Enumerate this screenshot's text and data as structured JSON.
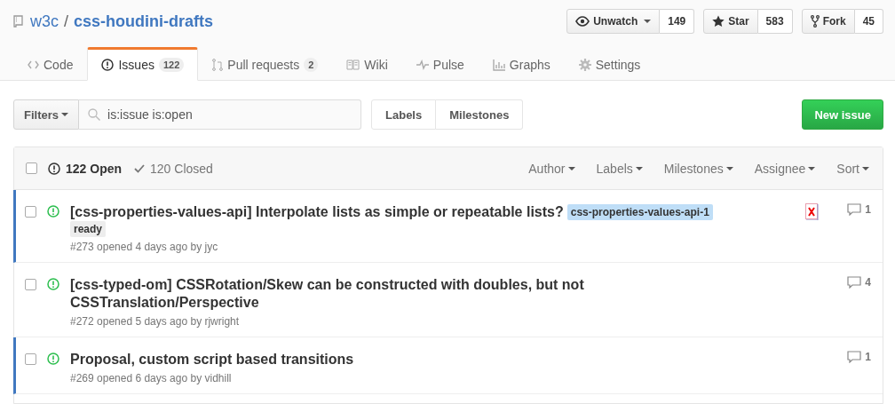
{
  "repo": {
    "owner": "w3c",
    "separator": "/",
    "name": "css-houdini-drafts"
  },
  "actions": [
    {
      "kind": "watch",
      "label": "Unwatch",
      "dropdown": true,
      "count": "149"
    },
    {
      "kind": "star",
      "label": "Star",
      "dropdown": false,
      "count": "583"
    },
    {
      "kind": "fork",
      "label": "Fork",
      "dropdown": false,
      "count": "45"
    }
  ],
  "tabs": [
    {
      "kind": "code",
      "label": "Code",
      "selected": false
    },
    {
      "kind": "issues",
      "label": "Issues",
      "count": "122",
      "selected": true
    },
    {
      "kind": "pulls",
      "label": "Pull requests",
      "count": "2",
      "selected": false
    },
    {
      "kind": "wiki",
      "label": "Wiki",
      "selected": false
    },
    {
      "kind": "pulse",
      "label": "Pulse",
      "selected": false
    },
    {
      "kind": "graphs",
      "label": "Graphs",
      "selected": false
    },
    {
      "kind": "settings",
      "label": "Settings",
      "selected": false
    }
  ],
  "filters": {
    "button": "Filters",
    "search_value": "is:issue is:open",
    "links": [
      "Labels",
      "Milestones"
    ],
    "new_button": "New issue"
  },
  "list_header": {
    "select_all_checked": false,
    "open": {
      "text": "122 Open",
      "selected": true
    },
    "closed": {
      "text": "120 Closed",
      "selected": false
    },
    "menus": [
      "Author",
      "Labels",
      "Milestones",
      "Assignee",
      "Sort"
    ]
  },
  "issues": [
    {
      "title": "[css-properties-values-api] Interpolate lists as simple or repeatable lists?",
      "labels": [
        {
          "text": "css-properties-values-api-1",
          "color": "#bfdef7"
        },
        {
          "text": "ready",
          "color": "#ededed"
        }
      ],
      "meta": "#273 opened 4 days ago by jyc",
      "unread": true,
      "broken_avatar": true,
      "comments": "1"
    },
    {
      "title": "[css-typed-om] CSSRotation/Skew can be constructed with doubles, but not CSSTranslation/Perspective",
      "meta": "#272 opened 5 days ago by rjwright",
      "unread": false,
      "broken_avatar": false,
      "comments": "4"
    },
    {
      "title": "Proposal, custom script based transitions",
      "meta": "#269 opened 6 days ago by vidhill",
      "unread": true,
      "broken_avatar": false,
      "comments": "1"
    }
  ]
}
